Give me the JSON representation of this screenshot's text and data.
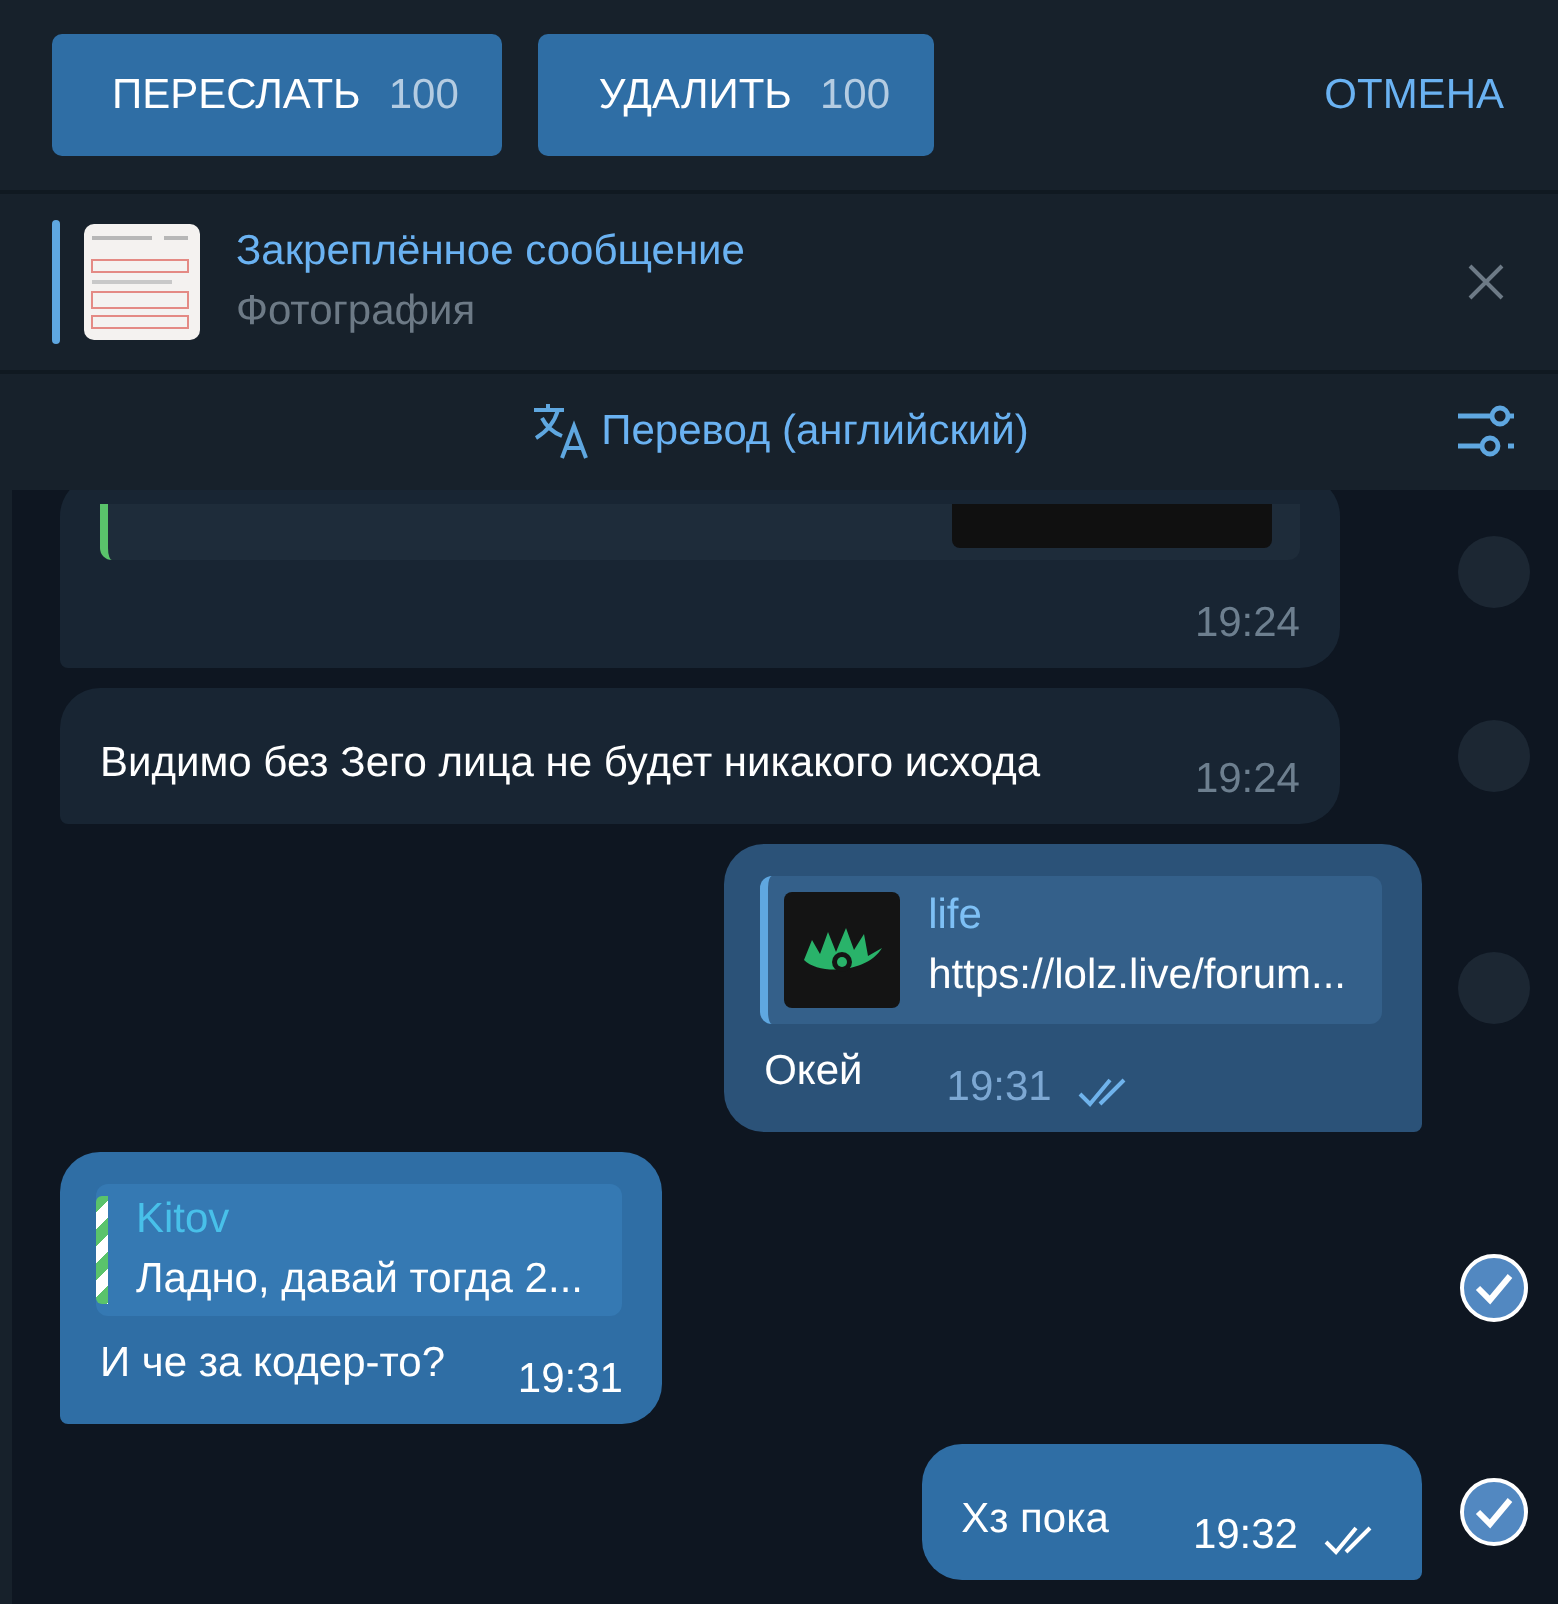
{
  "header": {
    "buttons": [
      {
        "label": "ПЕРЕСЛАТЬ",
        "count": "100"
      },
      {
        "label": "УДАЛИТЬ",
        "count": "100"
      }
    ],
    "cancel": "ОТМЕНА"
  },
  "pinned": {
    "title": "Закреплённое сообщение",
    "subtitle": "Фотография"
  },
  "translate": {
    "label": "Перевод (английский)"
  },
  "messages": [
    {
      "kind": "in",
      "selected": false,
      "preview": {
        "kind": "cut"
      },
      "time": "19:24",
      "read": false
    },
    {
      "kind": "in",
      "selected": false,
      "text": "Видимо без Зего лица не будет никакого исхода",
      "time": "19:24",
      "read": false
    },
    {
      "kind": "out",
      "selected": false,
      "preview": {
        "kind": "link",
        "title": "life",
        "url": "https://lolz.live/forum..."
      },
      "text": "Окей",
      "time": "19:31",
      "read": true
    },
    {
      "kind": "in",
      "selected": true,
      "preview": {
        "kind": "reply",
        "title": "Kitov",
        "url": "Ладно, давай тогда 2..."
      },
      "text": "И че за кодер-то?",
      "time": "19:31",
      "read": false
    },
    {
      "kind": "out",
      "selected": true,
      "text": "Хз пока",
      "time": "19:32",
      "read": true
    }
  ]
}
